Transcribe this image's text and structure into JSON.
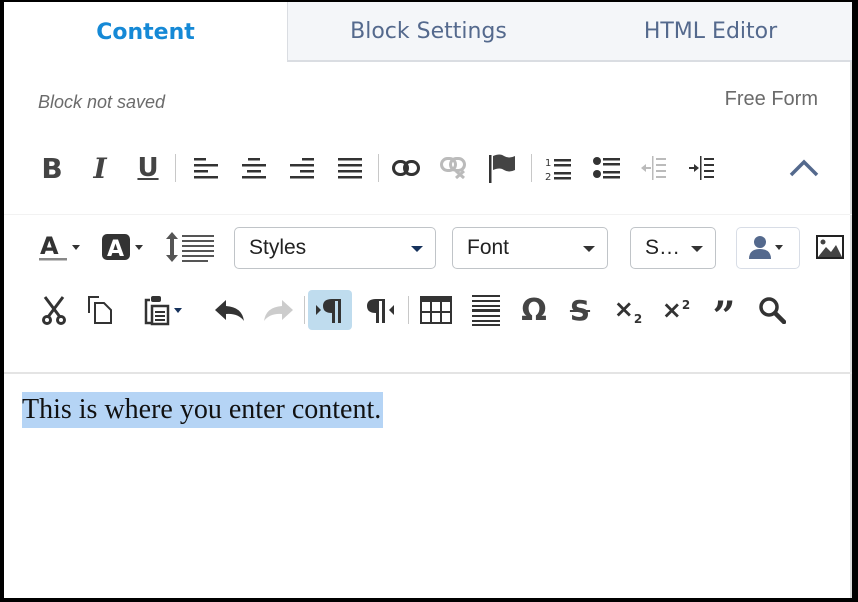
{
  "tabs": [
    {
      "label": "Content",
      "active": true
    },
    {
      "label": "Block Settings",
      "active": false
    },
    {
      "label": "HTML Editor",
      "active": false
    }
  ],
  "status_text": "Block not saved",
  "mode_label": "Free Form",
  "toolbar": {
    "row1": [
      "bold",
      "italic",
      "underline",
      "align-left",
      "align-center",
      "align-right",
      "justify",
      "link",
      "unlink",
      "anchor",
      "numbered-list",
      "bulleted-list",
      "decrease-indent",
      "increase-indent",
      "collapse-toolbar"
    ],
    "row2": {
      "styles_label": "Styles",
      "font_label": "Font",
      "size_label": "S…",
      "icons": [
        "text-color",
        "background-color",
        "line-height",
        "merge-field",
        "image"
      ]
    },
    "row3": [
      "cut",
      "copy",
      "paste",
      "undo",
      "redo",
      "ltr-direction",
      "rtl-direction",
      "table",
      "horizontal-rule",
      "special-character",
      "strikethrough",
      "subscript",
      "superscript",
      "blockquote",
      "find"
    ],
    "active_button": "ltr-direction"
  },
  "editor": {
    "content": "This is where you enter content."
  },
  "colors": {
    "active_tab": "#1589d6",
    "selection": "#b5d4f5",
    "accent_icon": "#54698d"
  }
}
